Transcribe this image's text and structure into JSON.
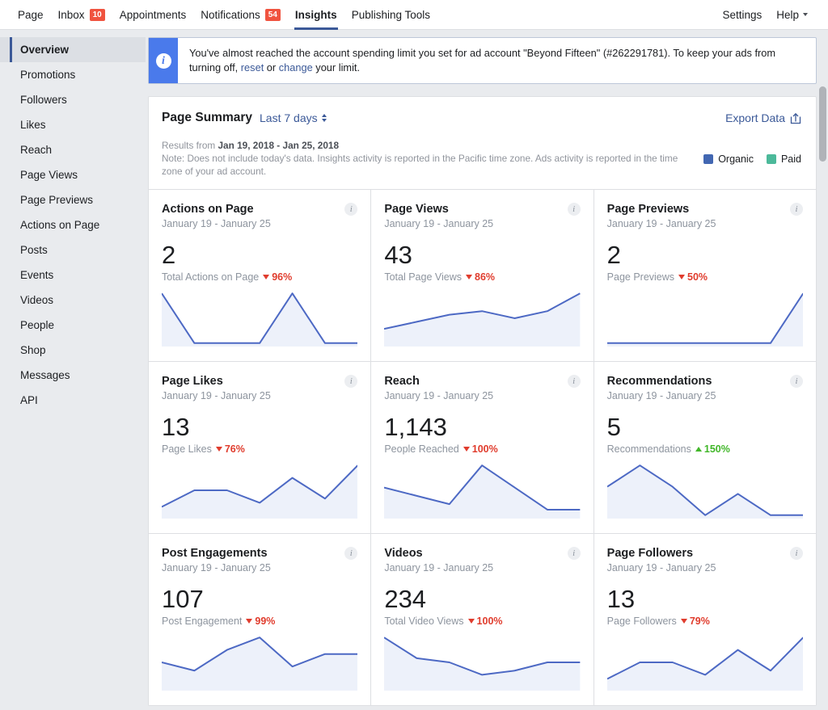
{
  "colors": {
    "brand_blue": "#3b5998",
    "line_blue": "#4d69c4",
    "area_blue": "#edf1fa",
    "organic": "#4267b2",
    "paid": "#4cb99a",
    "badge_red": "#f0533f",
    "down_red": "#e03c2d",
    "up_green": "#42b72a",
    "page_bg": "#e9ebee"
  },
  "topnav": {
    "left_items": [
      {
        "label": "Page",
        "badge": null,
        "active": false
      },
      {
        "label": "Inbox",
        "badge": "10",
        "active": false
      },
      {
        "label": "Appointments",
        "badge": null,
        "active": false
      },
      {
        "label": "Notifications",
        "badge": "54",
        "active": false
      },
      {
        "label": "Insights",
        "badge": null,
        "active": true
      },
      {
        "label": "Publishing Tools",
        "badge": null,
        "active": false
      }
    ],
    "right_items": [
      {
        "label": "Settings",
        "caret": false
      },
      {
        "label": "Help",
        "caret": true
      }
    ]
  },
  "sidebar": {
    "items": [
      {
        "label": "Overview",
        "active": true
      },
      {
        "label": "Promotions",
        "active": false
      },
      {
        "label": "Followers",
        "active": false
      },
      {
        "label": "Likes",
        "active": false
      },
      {
        "label": "Reach",
        "active": false
      },
      {
        "label": "Page Views",
        "active": false
      },
      {
        "label": "Page Previews",
        "active": false
      },
      {
        "label": "Actions on Page",
        "active": false
      },
      {
        "label": "Posts",
        "active": false
      },
      {
        "label": "Events",
        "active": false
      },
      {
        "label": "Videos",
        "active": false
      },
      {
        "label": "People",
        "active": false
      },
      {
        "label": "Shop",
        "active": false
      },
      {
        "label": "Messages",
        "active": false
      },
      {
        "label": "API",
        "active": false
      }
    ]
  },
  "alert": {
    "icon": "info-icon",
    "text_before": "You've almost reached the account spending limit you set for ad account \"Beyond Fifteen\" (#262291781). To keep your ads from turning off, ",
    "link_reset": "reset",
    "text_middle": " or ",
    "link_change": "change",
    "text_after": " your limit."
  },
  "summary": {
    "title": "Page Summary",
    "date_range_label": "Last 7 days",
    "export_label": "Export Data",
    "results_prefix": "Results from ",
    "results_dates": "Jan 19, 2018 - Jan 25, 2018",
    "note": "Note: Does not include today's data. Insights activity is reported in the Pacific time zone. Ads activity is reported in the time zone of your ad account.",
    "legend": [
      {
        "label": "Organic",
        "color": "#4267b2"
      },
      {
        "label": "Paid",
        "color": "#4cb99a"
      }
    ]
  },
  "chart_data": [
    {
      "type": "line",
      "title": "Actions on Page",
      "range": "January 19 - January 25",
      "value": "2",
      "metric_label": "Total Actions on Page",
      "delta": "96%",
      "direction": "down",
      "x": [
        0,
        1,
        2,
        3,
        4,
        5,
        6
      ],
      "values": [
        1,
        0,
        0,
        0,
        1,
        0,
        0
      ],
      "ylim": [
        0,
        1
      ]
    },
    {
      "type": "line",
      "title": "Page Views",
      "range": "January 19 - January 25",
      "value": "43",
      "metric_label": "Total Page Views",
      "delta": "86%",
      "direction": "down",
      "x": [
        0,
        1,
        2,
        3,
        4,
        5,
        6
      ],
      "values": [
        4,
        6,
        8,
        9,
        7,
        9,
        14
      ],
      "ylim": [
        0,
        14
      ]
    },
    {
      "type": "line",
      "title": "Page Previews",
      "range": "January 19 - January 25",
      "value": "2",
      "metric_label": "Page Previews",
      "delta": "50%",
      "direction": "down",
      "x": [
        0,
        1,
        2,
        3,
        4,
        5,
        6
      ],
      "values": [
        0,
        0,
        0,
        0,
        0,
        0,
        2
      ],
      "ylim": [
        0,
        2
      ]
    },
    {
      "type": "line",
      "title": "Page Likes",
      "range": "January 19 - January 25",
      "value": "13",
      "metric_label": "Page Likes",
      "delta": "76%",
      "direction": "down",
      "x": [
        0,
        1,
        2,
        3,
        4,
        5,
        6
      ],
      "values": [
        1,
        3,
        3,
        1.5,
        4.5,
        2,
        6
      ],
      "ylim": [
        0,
        6
      ]
    },
    {
      "type": "line",
      "title": "Reach",
      "range": "January 19 - January 25",
      "value": "1,143",
      "metric_label": "People Reached",
      "delta": "100%",
      "direction": "down",
      "x": [
        0,
        1,
        2,
        3,
        4,
        5,
        6
      ],
      "values": [
        5,
        3.5,
        2,
        9,
        5,
        1,
        1
      ],
      "ylim": [
        0,
        9
      ]
    },
    {
      "type": "line",
      "title": "Recommendations",
      "range": "January 19 - January 25",
      "value": "5",
      "metric_label": "Recommendations",
      "delta": "150%",
      "direction": "up",
      "x": [
        0,
        1,
        2,
        3,
        4,
        5,
        6
      ],
      "values": [
        4,
        7,
        4,
        0,
        3,
        0,
        0
      ],
      "ylim": [
        0,
        7
      ]
    },
    {
      "type": "line",
      "title": "Post Engagements",
      "range": "January 19 - January 25",
      "value": "107",
      "metric_label": "Post Engagement",
      "delta": "99%",
      "direction": "down",
      "x": [
        0,
        1,
        2,
        3,
        4,
        5,
        6
      ],
      "values": [
        3,
        2,
        4.5,
        6,
        2.5,
        4,
        4
      ],
      "ylim": [
        0,
        6
      ]
    },
    {
      "type": "line",
      "title": "Videos",
      "range": "January 19 - January 25",
      "value": "234",
      "metric_label": "Total Video Views",
      "delta": "100%",
      "direction": "down",
      "x": [
        0,
        1,
        2,
        3,
        4,
        5,
        6
      ],
      "values": [
        6,
        3.5,
        3,
        1.5,
        2,
        3,
        3
      ],
      "ylim": [
        0,
        6
      ]
    },
    {
      "type": "line",
      "title": "Page Followers",
      "range": "January 19 - January 25",
      "value": "13",
      "metric_label": "Page Followers",
      "delta": "79%",
      "direction": "down",
      "x": [
        0,
        1,
        2,
        3,
        4,
        5,
        6
      ],
      "values": [
        1,
        3,
        3,
        1.5,
        4.5,
        2,
        6
      ],
      "ylim": [
        0,
        6
      ]
    }
  ]
}
